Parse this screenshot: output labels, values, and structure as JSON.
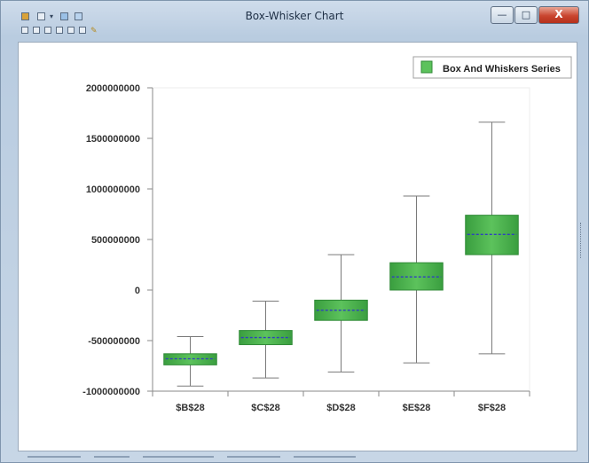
{
  "window": {
    "title": "Box-Whisker Chart",
    "close_glyph": "X",
    "minimize_glyph": "—",
    "maximize_glyph": "□"
  },
  "toolbar": {
    "icons": [
      "save-icon",
      "print-icon",
      "dropdown-icon",
      "copy-icon",
      "export-icon",
      "zoom-in-icon",
      "zoom-out-icon",
      "pan-icon",
      "grid-icon",
      "legend-icon",
      "settings-icon",
      "properties-icon"
    ]
  },
  "colors": {
    "box_fill": "#5cc25c",
    "box_stroke": "#2f8a36",
    "median": "#2f3fbf",
    "whisker": "#7a7a7a",
    "axis": "#8a8a8a"
  },
  "chart_data": {
    "type": "box",
    "title": "",
    "xlabel": "",
    "ylabel": "",
    "ylim": [
      -1000000000,
      2000000000
    ],
    "yticks": [
      2000000000,
      1500000000,
      1000000000,
      500000000,
      0,
      -500000000,
      -1000000000
    ],
    "ytick_labels": [
      "2000000000",
      "1500000000",
      "1000000000",
      "500000000",
      "0",
      "-500000000",
      "-1000000000"
    ],
    "categories": [
      "$B$28",
      "$C$28",
      "$D$28",
      "$E$28",
      "$F$28"
    ],
    "series": [
      {
        "name": "Box And Whiskers Series",
        "boxes": [
          {
            "min": -950000000,
            "q1": -740000000,
            "median": -680000000,
            "q3": -630000000,
            "max": -460000000
          },
          {
            "min": -870000000,
            "q1": -540000000,
            "median": -470000000,
            "q3": -400000000,
            "max": -110000000
          },
          {
            "min": -810000000,
            "q1": -300000000,
            "median": -200000000,
            "q3": -100000000,
            "max": 350000000
          },
          {
            "min": -720000000,
            "q1": 0,
            "median": 130000000,
            "q3": 270000000,
            "max": 930000000
          },
          {
            "min": -630000000,
            "q1": 350000000,
            "median": 550000000,
            "q3": 740000000,
            "max": 1660000000
          }
        ]
      }
    ],
    "legend": "top-right",
    "grid": false
  }
}
